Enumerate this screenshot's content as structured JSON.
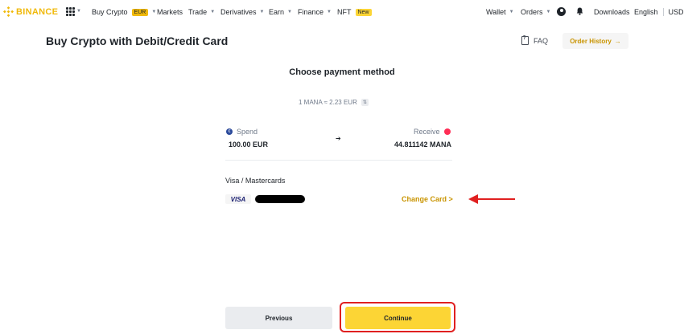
{
  "nav": {
    "logo_text": "BINANCE",
    "buy_crypto": "Buy Crypto",
    "buy_crypto_badge": "EUR",
    "markets": "Markets",
    "trade": "Trade",
    "derivatives": "Derivatives",
    "earn": "Earn",
    "finance": "Finance",
    "nft": "NFT",
    "nft_badge": "New",
    "wallet": "Wallet",
    "orders": "Orders",
    "downloads": "Downloads",
    "language": "English",
    "currency": "USD",
    "icons": [
      "grid-icon",
      "profile-icon",
      "bell-icon"
    ]
  },
  "header": {
    "title": "Buy Crypto with Debit/Credit Card",
    "faq": "FAQ",
    "order_history": "Order History",
    "order_history_arrow": "→"
  },
  "payment": {
    "section_title": "Choose payment method",
    "rate": "1 MANA ≈ 2.23 EUR",
    "spend_label": "Spend",
    "spend_icon_text": "€",
    "spend_value": "100.00 EUR",
    "receive_label": "Receive",
    "receive_value": "44.811142 MANA",
    "card_type": "Visa / Mastercards",
    "card_brand": "VISA",
    "change_card": "Change Card >"
  },
  "buttons": {
    "previous": "Previous",
    "continue": "Continue"
  },
  "colors": {
    "brand": "#f0b90b",
    "continue_bg": "#fcd535",
    "accent_text": "#c99400",
    "highlight_red": "#e02020"
  }
}
